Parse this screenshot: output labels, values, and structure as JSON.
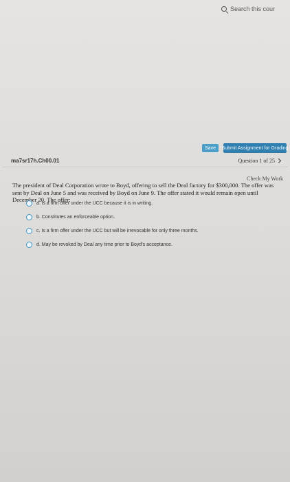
{
  "search": {
    "label": "Search this cour"
  },
  "toolbar": {
    "save_label": "Save",
    "submit_label": "Submit Assignment for Grading"
  },
  "header": {
    "assignment_id": "ma7sr17h.Ch00.01",
    "question_counter": "Question 1 of 25"
  },
  "check_work_label": "Check My Work",
  "question": {
    "text": "The president of Deal Corporation wrote to Boyd, offering to sell the Deal factory for $300,000. The offer was sent by Deal on June 5 and was received by Boyd on June 9. The offer stated it would remain open until December 20. The offer:",
    "options": [
      {
        "label": "a. is a firm offer under the UCC because it is in writing."
      },
      {
        "label": "b. Constitutes an enforceable option."
      },
      {
        "label": "c. Is a firm offer under the UCC but will be irrevocable for only three months."
      },
      {
        "label": "d. May be revoked by Deal any time prior to Boyd's acceptance."
      }
    ]
  },
  "colors": {
    "accent": "#2f7fb0",
    "save": "#4a9ec8",
    "radio": "#3d93c7"
  }
}
